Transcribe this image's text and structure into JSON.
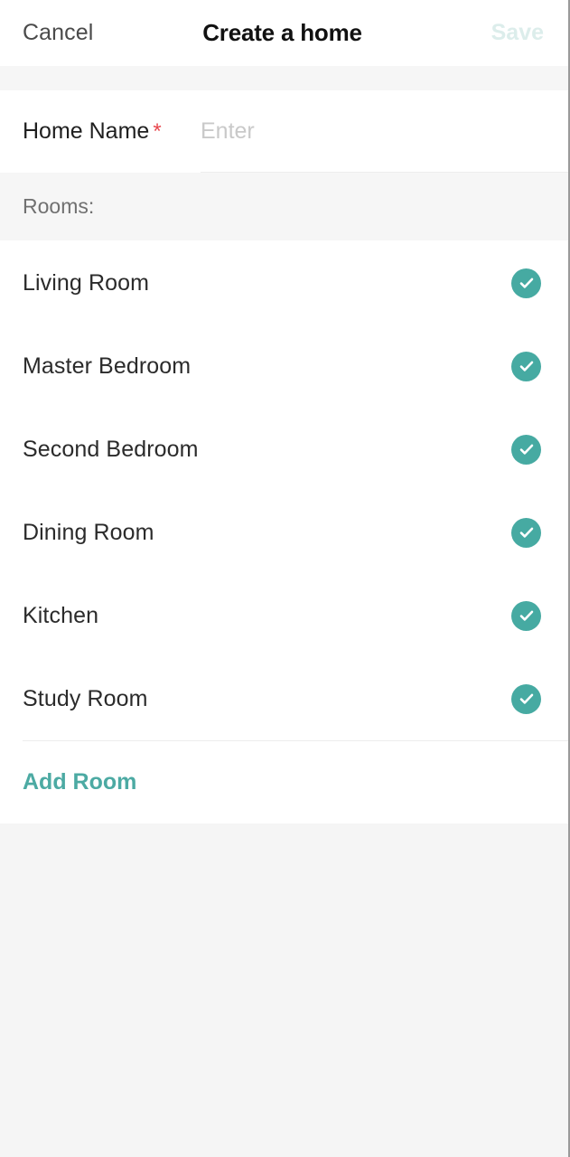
{
  "nav": {
    "cancel_label": "Cancel",
    "title": "Create a home",
    "save_label": "Save",
    "save_enabled": false
  },
  "form": {
    "home_name": {
      "label": "Home Name",
      "required_marker": "*",
      "value": "",
      "placeholder": "Enter"
    }
  },
  "rooms_section": {
    "header": "Rooms:",
    "rooms": [
      {
        "label": "Living Room",
        "checked": true,
        "check_icon": "check-circle-icon"
      },
      {
        "label": "Master Bedroom",
        "checked": true,
        "check_icon": "check-circle-icon"
      },
      {
        "label": "Second Bedroom",
        "checked": true,
        "check_icon": "check-circle-icon"
      },
      {
        "label": "Dining Room",
        "checked": true,
        "check_icon": "check-circle-icon"
      },
      {
        "label": "Kitchen",
        "checked": true,
        "check_icon": "check-circle-icon"
      },
      {
        "label": "Study Room",
        "checked": true,
        "check_icon": "check-circle-icon"
      }
    ],
    "add_room_label": "Add Room"
  },
  "colors": {
    "accent_teal": "#46aaa2",
    "accent_teal_text": "#4caaa3",
    "save_disabled": "#dcedeb",
    "required_red": "#e8484f",
    "page_background": "#f5f5f5",
    "card_background": "#ffffff",
    "section_background": "#f6f6f6",
    "primary_text": "#2b2b2b",
    "secondary_text": "#707070",
    "placeholder_text": "#c9c9c9"
  }
}
